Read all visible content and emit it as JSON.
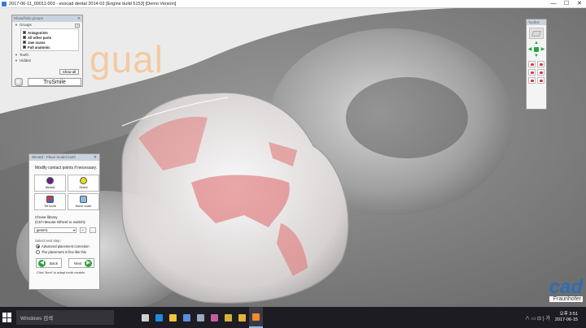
{
  "window": {
    "title": "2017-06-11_00011-003 - exocad dental 2014-02 [Engine build 5153] [Demo Version]",
    "controls": [
      "—",
      "☐",
      "✕"
    ]
  },
  "viewport": {
    "overlay_text": "gual",
    "logo_main": "cad",
    "logo_sub": "Fraunhofer"
  },
  "show_hide_panel": {
    "title": "Show/hide groups",
    "groups_label": "Groups",
    "help": "?",
    "groups": [
      {
        "label": "Antagonists",
        "checked": true
      },
      {
        "label": "All other parts",
        "checked": true
      },
      {
        "label": "Jaw scans",
        "checked": true
      },
      {
        "label": "Full anatomic",
        "checked": true
      }
    ],
    "tooth_label": "Tooth",
    "hidden_label": "Hidden",
    "show_all": "Show all",
    "trusmile": "TruSmile"
  },
  "toolbar": {
    "title": "Toolbar"
  },
  "wizard": {
    "title": "Wizard - Place model tooth",
    "instruction": "Modify contact points if necessary.",
    "buttons": [
      {
        "label": "Mesial",
        "icon": "mesial-contact-icon"
      },
      {
        "label": "Distal",
        "icon": "distal-contact-icon"
      },
      {
        "label": "Tilt tooth",
        "icon": "tilt-tooth-icon"
      },
      {
        "label": "Move tooth",
        "icon": "move-tooth-icon"
      }
    ],
    "library_label_1": "Chose library",
    "library_label_2": "(Ctrl+Mouse Wheel to switch):",
    "library_value": "generic",
    "library_prev": "<",
    "library_add": "+",
    "library_more": "...",
    "next_step_label": "Select next step:",
    "options": [
      {
        "label": "Advanced placement correction",
        "selected": true
      },
      {
        "label": "The placement is fine like this",
        "selected": false
      }
    ],
    "back_label": "Back",
    "next_label": "Next",
    "hint": "Click 'Next' to adapt tooth models"
  },
  "taskbar": {
    "search_placeholder": "Windows 검색",
    "tray": "∧  ▭  ⊡  )  가",
    "time": "오후 3:51",
    "date": "2017-06-15",
    "icons": [
      {
        "name": "task-view-icon",
        "color": "#cfcfcf"
      },
      {
        "name": "edge-icon",
        "color": "#1f8ae0"
      },
      {
        "name": "file-explorer-icon",
        "color": "#f3c338"
      },
      {
        "name": "store-icon",
        "color": "#5a8ed8"
      },
      {
        "name": "app-icon-1",
        "color": "#9aa8c4"
      },
      {
        "name": "app-icon-2",
        "color": "#c35ca0"
      },
      {
        "name": "app-icon-3",
        "color": "#d6b23c"
      },
      {
        "name": "chrome-icon",
        "color": "#e4b33a"
      },
      {
        "name": "exocad-icon",
        "color": "#f08a2a"
      }
    ]
  }
}
